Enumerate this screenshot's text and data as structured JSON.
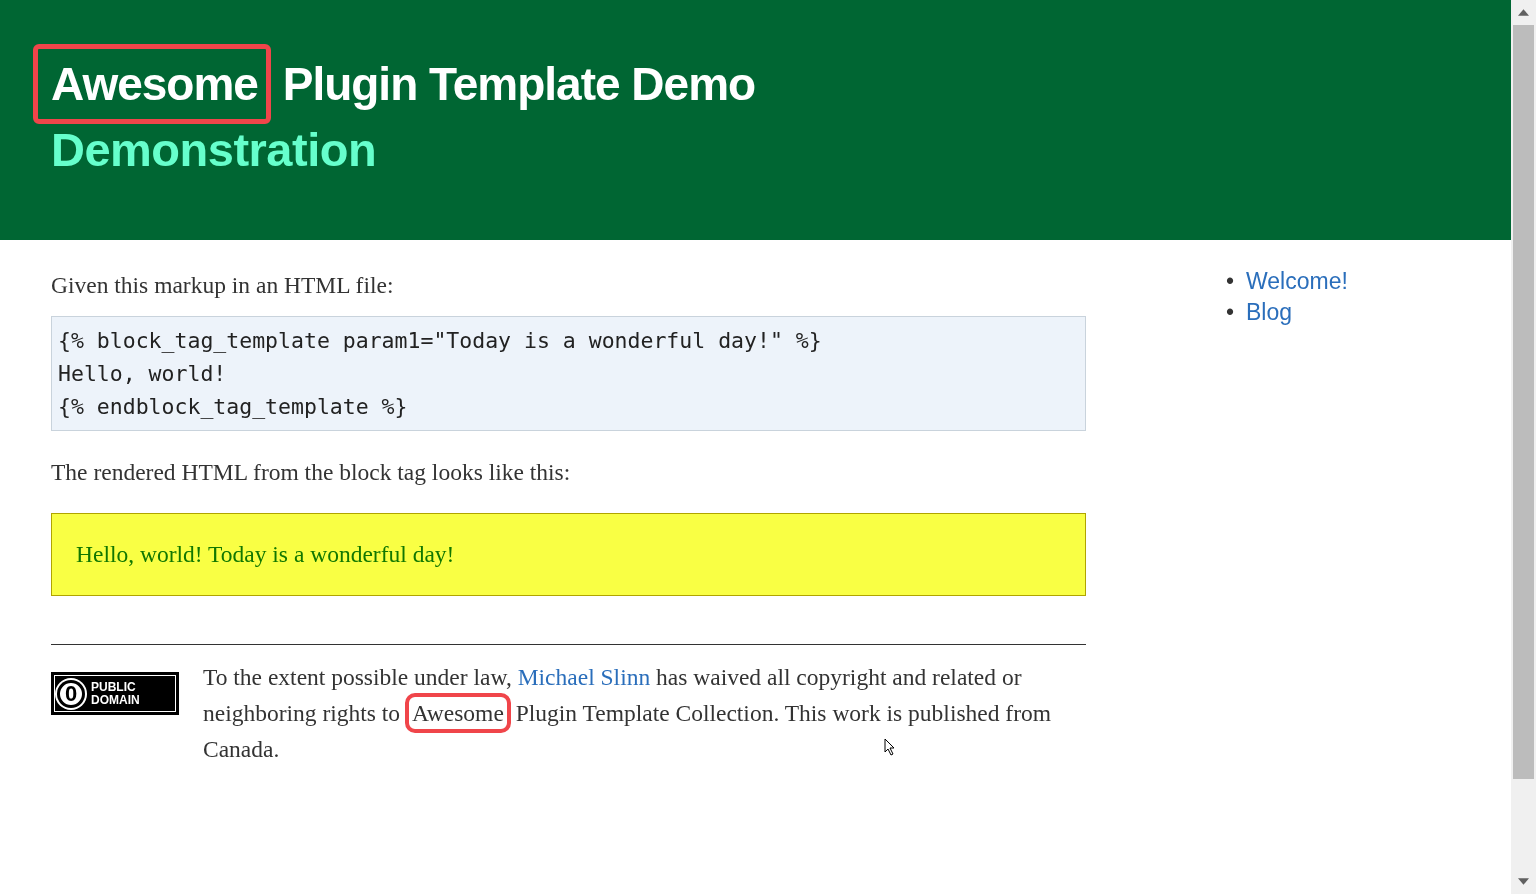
{
  "header": {
    "title": [
      {
        "kind": "highlight",
        "text": "Awesome"
      },
      {
        "kind": "text",
        "text": " Plugin Template Demo"
      }
    ],
    "subtitle": "Demonstration"
  },
  "intro": "Given this markup in an HTML file:",
  "code_lines": [
    "{% block_tag_template param1=\"Today is a wonderful day!\" %}",
    "Hello, world!",
    "{% endblock_tag_template %}"
  ],
  "result_intro": "The rendered HTML from the block tag looks like this:",
  "result": "Hello, world! Today is a wonderful day!",
  "footer": {
    "badge": {
      "symbol": "0",
      "lines": [
        "PUBLIC",
        "DOMAIN"
      ]
    },
    "sentence": [
      {
        "kind": "text",
        "text": "To the extent possible under law, "
      },
      {
        "kind": "link",
        "text": "Michael Slinn"
      },
      {
        "kind": "text",
        "text": " has waived all copyright and related or neighboring rights to "
      },
      {
        "kind": "highlight",
        "text": "Awesome"
      },
      {
        "kind": "text",
        "text": " Plugin Template Collection. This work is published from Canada."
      }
    ]
  },
  "sidebar": {
    "items": [
      {
        "bullet": "•",
        "label": "Welcome!"
      },
      {
        "bullet": "•",
        "label": "Blog"
      }
    ]
  }
}
